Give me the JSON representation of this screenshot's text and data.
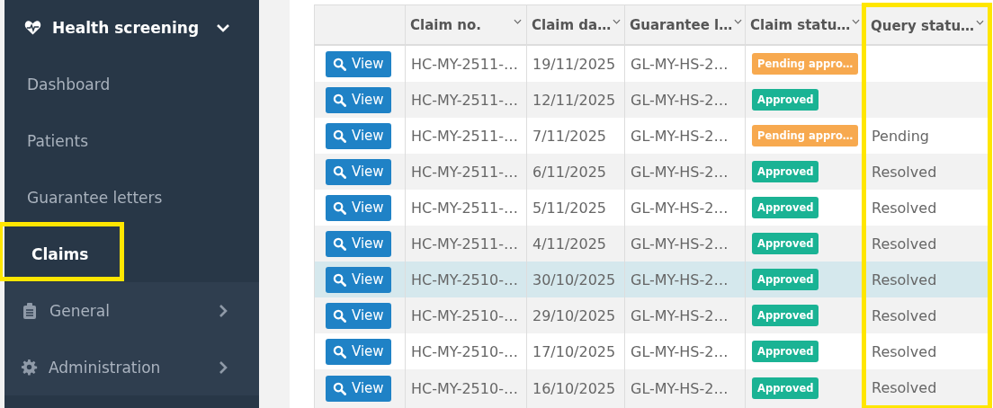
{
  "sidebar": {
    "groups": [
      {
        "label": "Health screening",
        "kind": "heart",
        "expanded": true,
        "children": [
          {
            "label": "Dashboard",
            "selected": false,
            "highlighted": false
          },
          {
            "label": "Patients",
            "selected": false,
            "highlighted": false
          },
          {
            "label": "Guarantee letters",
            "selected": false,
            "highlighted": false
          },
          {
            "label": "Claims",
            "selected": true,
            "highlighted": true
          }
        ]
      },
      {
        "label": "General",
        "kind": "clipboard",
        "expanded": false
      },
      {
        "label": "Administration",
        "kind": "gear",
        "expanded": false
      }
    ]
  },
  "table": {
    "columns": [
      {
        "sortable": false,
        "highlighted": false
      },
      {
        "label": "Claim no.",
        "sortable": true,
        "highlighted": false
      },
      {
        "label": "Claim da…",
        "sortable": true,
        "highlighted": false
      },
      {
        "label": "Guarantee l…",
        "sortable": true,
        "highlighted": false
      },
      {
        "label": "Claim statu…",
        "sortable": true,
        "highlighted": false
      },
      {
        "label": "Query statu…",
        "sortable": true,
        "highlighted": true
      }
    ],
    "rows": [
      {
        "action": "View",
        "claim_no": "HC-MY-2511-…",
        "claim_date": "19/11/2025",
        "guarantee_letter": "GL-MY-HS-2…",
        "claim_status": {
          "label": "Pending appro…",
          "kind": "pending"
        },
        "selected": false
      },
      {
        "action": "View",
        "claim_no": "HC-MY-2511-…",
        "claim_date": "12/11/2025",
        "guarantee_letter": "GL-MY-HS-2…",
        "claim_status": {
          "label": "Approved",
          "kind": "approved"
        },
        "selected": false
      },
      {
        "action": "View",
        "claim_no": "HC-MY-2511-…",
        "claim_date": "7/11/2025",
        "guarantee_letter": "GL-MY-HS-2…",
        "claim_status": {
          "label": "Pending appro…",
          "kind": "pending"
        },
        "query_status": "Pending",
        "selected": false
      },
      {
        "action": "View",
        "claim_no": "HC-MY-2511-…",
        "claim_date": "6/11/2025",
        "guarantee_letter": "GL-MY-HS-2…",
        "claim_status": {
          "label": "Approved",
          "kind": "approved"
        },
        "query_status": "Resolved",
        "selected": false
      },
      {
        "action": "View",
        "claim_no": "HC-MY-2511-…",
        "claim_date": "5/11/2025",
        "guarantee_letter": "GL-MY-HS-2…",
        "claim_status": {
          "label": "Approved",
          "kind": "approved"
        },
        "query_status": "Resolved",
        "selected": false
      },
      {
        "action": "View",
        "claim_no": "HC-MY-2511-…",
        "claim_date": "4/11/2025",
        "guarantee_letter": "GL-MY-HS-2…",
        "claim_status": {
          "label": "Approved",
          "kind": "approved"
        },
        "query_status": "Resolved",
        "selected": false
      },
      {
        "action": "View",
        "claim_no": "HC-MY-2510-…",
        "claim_date": "30/10/2025",
        "guarantee_letter": "GL-MY-HS-2…",
        "claim_status": {
          "label": "Approved",
          "kind": "approved"
        },
        "query_status": "Resolved",
        "selected": true
      },
      {
        "action": "View",
        "claim_no": "HC-MY-2510-…",
        "claim_date": "29/10/2025",
        "guarantee_letter": "GL-MY-HS-2…",
        "claim_status": {
          "label": "Approved",
          "kind": "approved"
        },
        "query_status": "Resolved",
        "selected": false
      },
      {
        "action": "View",
        "claim_no": "HC-MY-2510-…",
        "claim_date": "17/10/2025",
        "guarantee_letter": "GL-MY-HS-2…",
        "claim_status": {
          "label": "Approved",
          "kind": "approved"
        },
        "query_status": "Resolved",
        "selected": false
      },
      {
        "action": "View",
        "claim_no": "HC-MY-2510-…",
        "claim_date": "16/10/2025",
        "guarantee_letter": "GL-MY-HS-2…",
        "claim_status": {
          "label": "Approved",
          "kind": "approved"
        },
        "query_status": "Resolved",
        "selected": false
      }
    ]
  }
}
